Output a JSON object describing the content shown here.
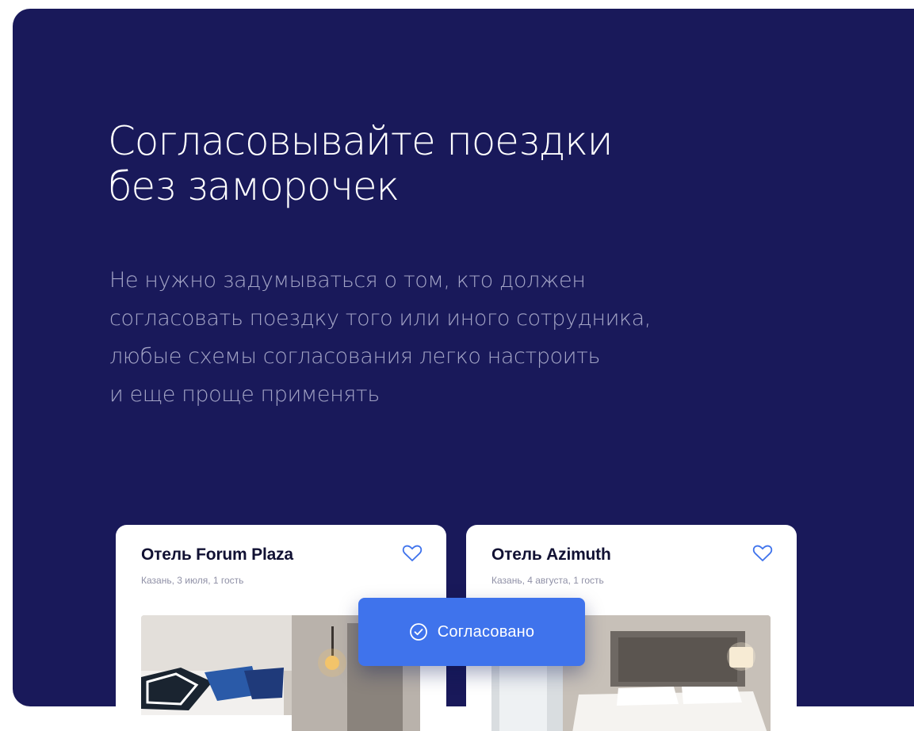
{
  "hero": {
    "headline_lines": [
      "Согласовывайте поездки",
      "без заморочек"
    ],
    "lead_lines": [
      "Не нужно задумываться о том, кто должен",
      "согласовать поездку того или иного сотрудника,",
      "любые схемы согласования легко настроить",
      "и еще проще применять"
    ]
  },
  "cards": [
    {
      "title": "Отель Forum Plaza",
      "subtitle": "Казань, 3 июля, 1 гость"
    },
    {
      "title": "Отель Azimuth",
      "subtitle": "Казань, 4 августа, 1 гость"
    }
  ],
  "badge": {
    "label": "Согласовано",
    "icon": "check-circle-icon"
  },
  "colors": {
    "panel_background": "#19195a",
    "accent_blue": "#3f73ec",
    "lead_text": "#a3a4c6",
    "card_title": "#111133",
    "card_subtitle": "#8f90a6"
  }
}
